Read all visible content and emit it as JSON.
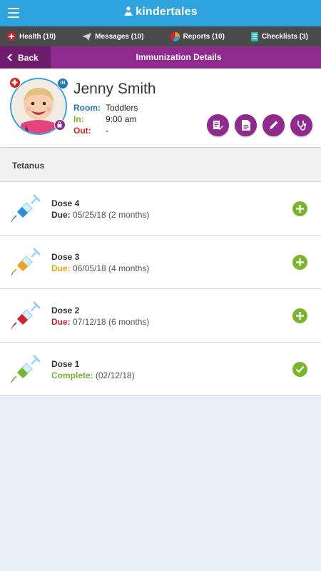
{
  "app": {
    "brand": "kindertales"
  },
  "nav": [
    {
      "label": "Health (10)",
      "icon": "health-icon",
      "color": "#d0232a"
    },
    {
      "label": "Messages (10)",
      "icon": "send-icon",
      "color": "#cfcfcf"
    },
    {
      "label": "Reports (10)",
      "icon": "pie-chart-icon",
      "color": "#e8a02a"
    },
    {
      "label": "Checklists (3)",
      "icon": "checklist-icon",
      "color": "#2fb5a8"
    }
  ],
  "titlebar": {
    "back_label": "Back",
    "title": "Immunization Details"
  },
  "child": {
    "name": "Jenny Smith",
    "in_badge": "IN",
    "room_label": "Room:",
    "room": "Toddlers",
    "in_label": "In:",
    "in_time": "9:00 am",
    "out_label": "Out:",
    "out_time": "-"
  },
  "actions": [
    "edit-notes-icon",
    "document-icon",
    "pencil-icon",
    "stethoscope-icon"
  ],
  "section": {
    "title": "Tetanus"
  },
  "doses": [
    {
      "name": "Dose 4",
      "status_label": "Due:",
      "value": "05/25/18 (2  months)",
      "label_color": "#333333",
      "syringe_color": "#2d8fd6",
      "status": "add"
    },
    {
      "name": "Dose 3",
      "status_label": "Due:",
      "value": "06/05/18 (4 months)",
      "label_color": "#f0a01e",
      "syringe_color": "#f0a01e",
      "status": "add"
    },
    {
      "name": "Dose 2",
      "status_label": "Due:",
      "value": "07/12/18 (6 months)",
      "label_color": "#d0232a",
      "syringe_color": "#d0232a",
      "status": "add"
    },
    {
      "name": "Dose 1",
      "status_label": "Complete:",
      "value": "(02/12/18)",
      "label_color": "#7ab530",
      "syringe_color": "#7ab530",
      "status": "complete"
    }
  ],
  "colors": {
    "header": "#2ea3dd",
    "nav": "#4a4a4a",
    "purple": "#8f2b8e",
    "green": "#7ab530"
  }
}
